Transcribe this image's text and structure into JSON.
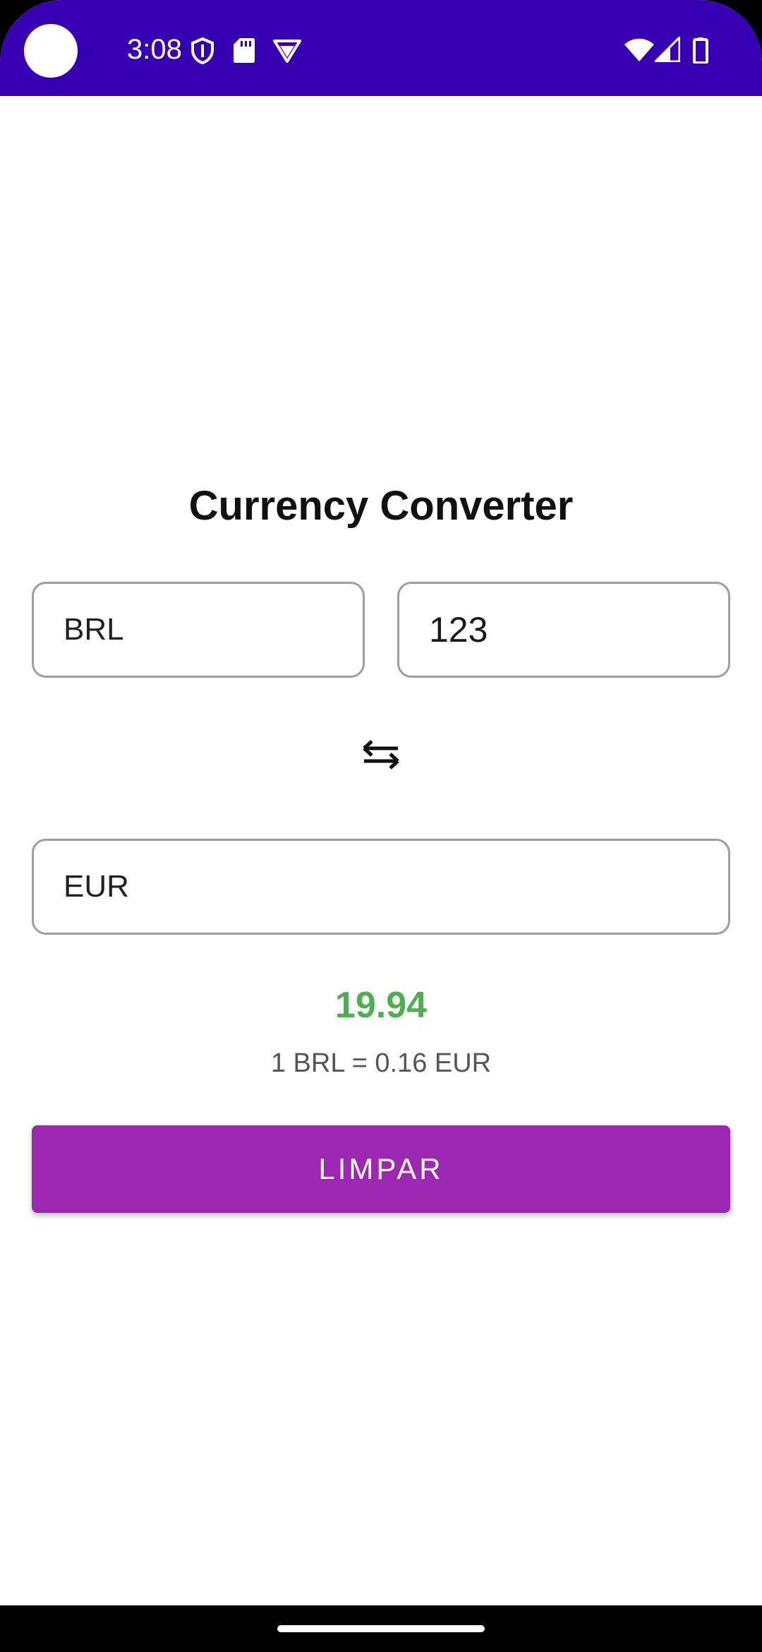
{
  "status_bar": {
    "time": "3:08",
    "icons": [
      "vpn-shield-icon",
      "sd-card-icon",
      "data-saver-icon",
      "wifi-icon",
      "cellular-signal-icon",
      "battery-icon"
    ]
  },
  "main": {
    "title": "Currency Converter",
    "from_currency": "BRL",
    "amount": "123",
    "to_currency": "EUR",
    "swap_icon": "swap-arrows-icon",
    "result": "19.94",
    "rate": "1 BRL = 0.16 EUR",
    "clear_button": "LIMPAR"
  },
  "colors": {
    "status_bar": "#3700b3",
    "result": "#4caf50",
    "button": "#9c27b0"
  }
}
